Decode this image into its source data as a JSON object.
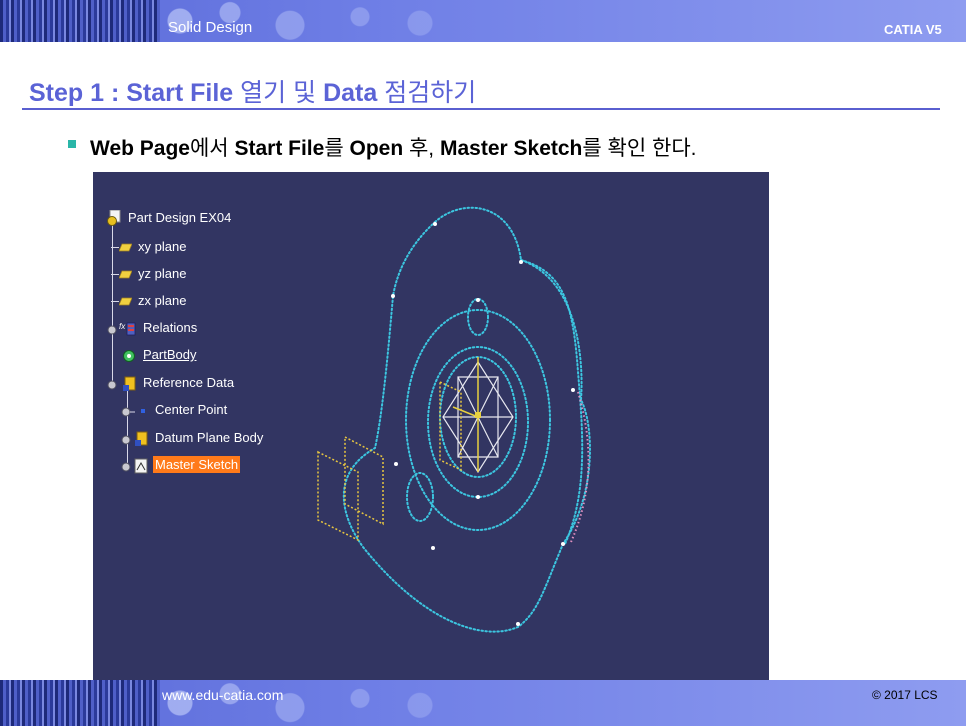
{
  "header": {
    "section": "Solid Design",
    "product": "CATIA V5"
  },
  "title": {
    "step": "Step 1 : Start File",
    "rest_1": " 열기 및 ",
    "data": "Data",
    "rest_2": " 점검하기"
  },
  "instruction": {
    "p1": "Web Page",
    "p2": "에서 ",
    "p3": "Start File",
    "p4": "를 ",
    "p5": "Open",
    "p6": " 후, ",
    "p7": "Master Sketch",
    "p8": "를 확인 한다."
  },
  "tree": {
    "root": "Part Design EX04",
    "items": [
      {
        "label": "xy plane",
        "icon": "plane-icon"
      },
      {
        "label": "yz plane",
        "icon": "plane-icon"
      },
      {
        "label": "zx plane",
        "icon": "plane-icon"
      },
      {
        "label": "Relations",
        "icon": "relations-icon"
      },
      {
        "label": "PartBody",
        "icon": "partbody-icon"
      },
      {
        "label": "Reference Data",
        "icon": "geometrical-set-icon"
      },
      {
        "label": "Center Point",
        "icon": "point-icon"
      },
      {
        "label": "Datum Plane Body",
        "icon": "geometrical-set-icon"
      },
      {
        "label": "Master Sketch",
        "icon": "sketch-icon"
      }
    ]
  },
  "footer": {
    "url": "www.edu-catia.com",
    "copyright": "© 2017 LCS"
  },
  "colors": {
    "accent": "#5b63d6",
    "viewport_bg": "#323562",
    "selection": "#ff7a1a",
    "sketch_curve": "#3cc6e0",
    "plane_outline": "#e8c640"
  }
}
